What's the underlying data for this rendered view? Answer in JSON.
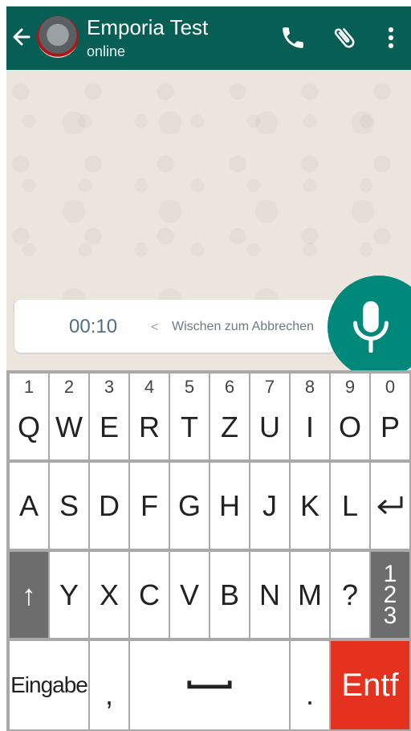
{
  "header": {
    "title": "Emporia Test",
    "status": "online",
    "colors": {
      "bar": "#075e54",
      "accent": "#00897b"
    },
    "icons": [
      "back-arrow-icon",
      "phone-icon",
      "paperclip-icon",
      "more-vert-icon"
    ]
  },
  "recording": {
    "timer": "00:10",
    "arrow": "<",
    "hint": "Wischen zum Abbrechen",
    "mic_icon": "microphone-icon"
  },
  "keyboard": {
    "row1": [
      {
        "num": "1",
        "key": "Q"
      },
      {
        "num": "2",
        "key": "W"
      },
      {
        "num": "3",
        "key": "E"
      },
      {
        "num": "4",
        "key": "R"
      },
      {
        "num": "5",
        "key": "T"
      },
      {
        "num": "6",
        "key": "Z"
      },
      {
        "num": "7",
        "key": "U"
      },
      {
        "num": "8",
        "key": "I"
      },
      {
        "num": "9",
        "key": "O"
      },
      {
        "num": "0",
        "key": "P"
      }
    ],
    "row2": [
      "A",
      "S",
      "D",
      "F",
      "G",
      "H",
      "J",
      "K",
      "L"
    ],
    "enter_icon": "return-arrow-icon",
    "shift": "↑",
    "row3": [
      "Y",
      "X",
      "C",
      "V",
      "B",
      "N",
      "M",
      "?"
    ],
    "numbers_label": [
      "1",
      "2",
      "3"
    ],
    "eingabe": "Eingabe",
    "comma": ",",
    "period": ".",
    "entf": "Entf",
    "space_icon": "space-bar-icon"
  }
}
